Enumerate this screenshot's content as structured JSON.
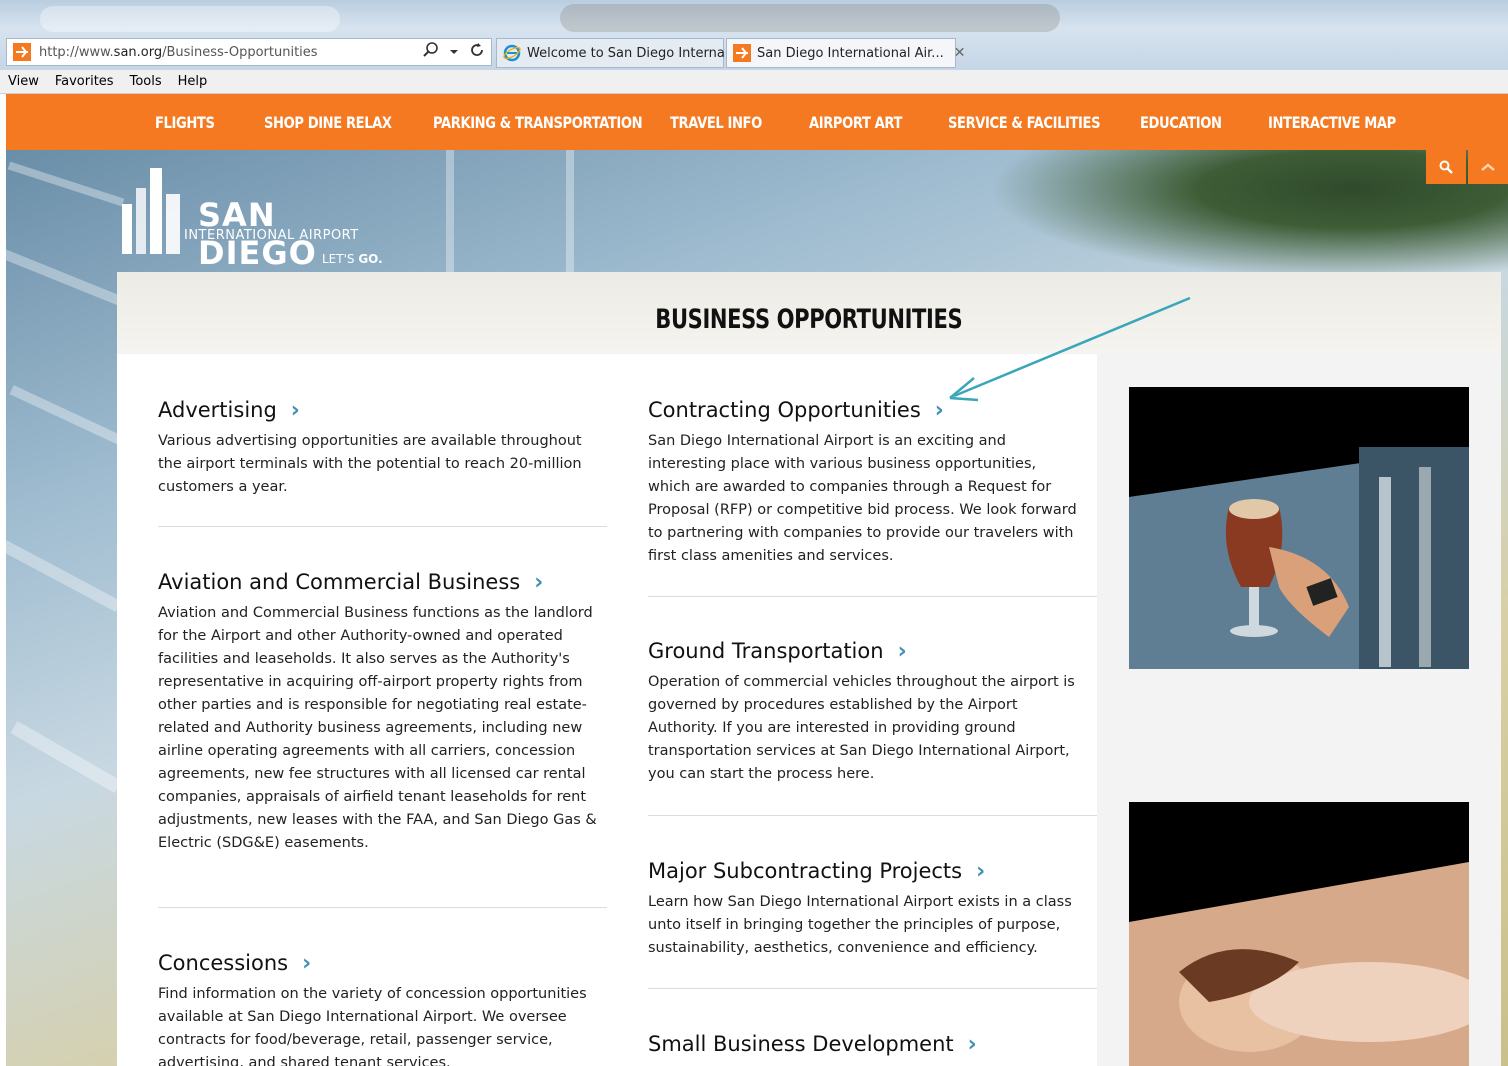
{
  "browser": {
    "url_prefix": "http://www.",
    "url_domain": "san.org",
    "url_path": "/Business-Opportunities",
    "tabs": [
      {
        "label": "Welcome to San Diego Interna..."
      },
      {
        "label": "San Diego International Air...",
        "close": "✕"
      }
    ],
    "menu": [
      "View",
      "Favorites",
      "Tools",
      "Help"
    ]
  },
  "nav": {
    "items": [
      {
        "label": "FLIGHTS"
      },
      {
        "label": "SHOP DINE RELAX"
      },
      {
        "label": "PARKING & TRANSPORTATION"
      },
      {
        "label": "TRAVEL INFO"
      },
      {
        "label": "AIRPORT ART"
      },
      {
        "label": "SERVICE & FACILITIES"
      },
      {
        "label": "EDUCATION"
      },
      {
        "label": "INTERACTIVE MAP"
      }
    ]
  },
  "logo": {
    "title": "SAN DIEGO",
    "subtitle": "INTERNATIONAL AIRPORT",
    "tagline_prefix": "LET'S ",
    "tagline_bold": "GO."
  },
  "page": {
    "title": "BUSINESS OPPORTUNITIES"
  },
  "sections_left": [
    {
      "title": "Advertising",
      "body": "Various advertising opportunities are available throughout the airport terminals with the potential to reach 20-million customers a year."
    },
    {
      "title": "Aviation and Commercial Business",
      "body": "Aviation and Commercial Business functions as the landlord for the Airport and other Authority-owned and operated facilities and leaseholds. It also serves as the Authority's representative in acquiring off-airport property rights from other parties and is responsible for negotiating real estate-related and Authority business agreements, including new airline operating agreements with all carriers, concession agreements, new fee structures with all licensed car rental companies, appraisals of airfield tenant leaseholds for rent adjustments, new leases with the FAA, and San Diego Gas & Electric (SDG&E) easements."
    },
    {
      "title": "Concessions",
      "body": "Find information on the variety of concession opportunities available at San Diego International Airport. We oversee contracts for food/beverage, retail, passenger service, advertising, and shared tenant services."
    }
  ],
  "sections_right": [
    {
      "title": "Contracting Opportunities",
      "body": "San Diego International Airport is an exciting and interesting place with various business opportunities, which are awarded to companies through a Request for Proposal (RFP) or competitive bid process. We look forward to partnering with companies to provide our travelers with first class amenities and services."
    },
    {
      "title": "Ground Transportation",
      "body": "Operation of commercial vehicles throughout the airport is governed by procedures established by the Airport Authority. If you are interested in providing ground transportation services at San Diego International Airport, you can start the process here."
    },
    {
      "title": "Major Subcontracting Projects",
      "body": "Learn how San Diego International Airport exists in a class unto itself in bringing together the principles of purpose, sustainability, aesthetics, convenience and efficiency."
    },
    {
      "title": "Small Business Development",
      "body": ""
    }
  ],
  "chevron": "›",
  "colors": {
    "brand_orange": "#f47920",
    "chevron_blue": "#3e8fb5",
    "annotation_teal": "#3aa6b9"
  },
  "icons": {
    "search": "search-icon",
    "collapse": "chevron-up-icon",
    "favicon": "plane-icon",
    "ie": "internet-explorer-icon"
  }
}
